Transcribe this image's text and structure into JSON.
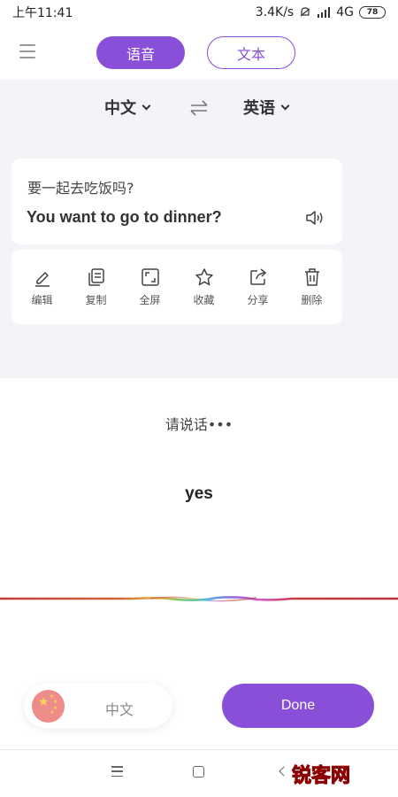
{
  "status_bar": {
    "time": "上午11:41",
    "network_speed": "3.4K/s",
    "network_type": "4G",
    "battery": "78"
  },
  "header": {
    "tab_voice": "语音",
    "tab_text": "文本",
    "active_tab": "voice"
  },
  "languages": {
    "source": "中文",
    "target": "英语"
  },
  "translation": {
    "source_text": "要一起去吃饭吗?",
    "target_text": "You want to go to dinner?"
  },
  "actions": [
    {
      "label": "编辑",
      "icon": "edit-icon"
    },
    {
      "label": "复制",
      "icon": "copy-icon"
    },
    {
      "label": "全屏",
      "icon": "fullscreen-icon"
    },
    {
      "label": "收藏",
      "icon": "star-icon"
    },
    {
      "label": "分享",
      "icon": "share-icon"
    },
    {
      "label": "删除",
      "icon": "delete-icon"
    }
  ],
  "listening": {
    "prompt": "请说话•••",
    "recognized": "yes"
  },
  "bottom": {
    "language_pill": "中文",
    "done_button": "Done"
  },
  "watermark": "锐客网",
  "colors": {
    "accent": "#8a4fd9",
    "panel_background": "#f4f3f8"
  }
}
